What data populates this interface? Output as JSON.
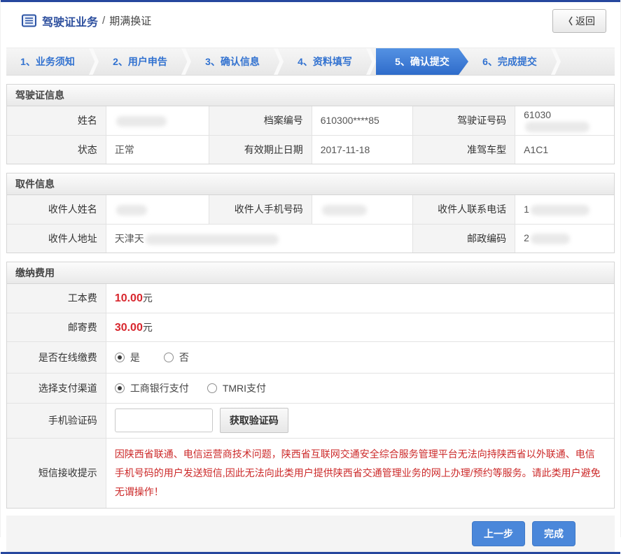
{
  "header": {
    "title": "驾驶证业务",
    "separator": "/",
    "subtitle": "期满换证",
    "back": {
      "icon": "〈",
      "label": "返回"
    }
  },
  "steps": [
    {
      "label": "1、业务须知",
      "active": false
    },
    {
      "label": "2、用户申告",
      "active": false
    },
    {
      "label": "3、确认信息",
      "active": false
    },
    {
      "label": "4、资料填写",
      "active": false
    },
    {
      "label": "5、确认提交",
      "active": true
    },
    {
      "label": "6、完成提交",
      "active": false
    }
  ],
  "sections": {
    "license": {
      "title": "驾驶证信息",
      "rows": [
        [
          {
            "label": "姓名",
            "value": "",
            "redacted": true
          },
          {
            "label": "档案编号",
            "value": "610300****85",
            "redacted": false
          },
          {
            "label": "驾驶证号码",
            "value": "61030",
            "redacted": true
          }
        ],
        [
          {
            "label": "状态",
            "value": "正常",
            "redacted": false
          },
          {
            "label": "有效期止日期",
            "value": "2017-11-18",
            "redacted": false
          },
          {
            "label": "准驾车型",
            "value": "A1C1",
            "redacted": false
          }
        ]
      ]
    },
    "pickup": {
      "title": "取件信息",
      "rows": [
        [
          {
            "label": "收件人姓名",
            "value": "",
            "redacted": true
          },
          {
            "label": "收件人手机号码",
            "value": "",
            "redacted": true
          },
          {
            "label": "收件人联系电话",
            "value": "1",
            "redacted": true
          }
        ],
        [
          {
            "label": "收件人地址",
            "value": "天津天",
            "redacted": true
          },
          {
            "label": "邮政编码",
            "value": "2",
            "redacted": true
          }
        ]
      ]
    },
    "payment": {
      "title": "缴纳费用",
      "fees": [
        {
          "label": "工本费",
          "amount": "10.00",
          "unit": "元"
        },
        {
          "label": "邮寄费",
          "amount": "30.00",
          "unit": "元"
        }
      ],
      "online": {
        "label": "是否在线缴费",
        "options": [
          {
            "label": "是",
            "checked": true
          },
          {
            "label": "否",
            "checked": false
          }
        ]
      },
      "channel": {
        "label": "选择支付渠道",
        "options": [
          {
            "label": "工商银行支付",
            "checked": true
          },
          {
            "label": "TMRI支付",
            "checked": false
          }
        ]
      },
      "code": {
        "label": "手机验证码",
        "input_value": "",
        "button_label": "获取验证码"
      },
      "notice": {
        "label": "短信接收提示",
        "text": "因陕西省联通、电信运营商技术问题，陕西省互联网交通安全综合服务管理平台无法向持陕西省以外联通、电信手机号码的用户发送短信,因此无法向此类用户提供陕西省交通管理业务的网上办理/预约等服务。请此类用户避免无谓操作！"
      }
    }
  },
  "footer": {
    "prev_label": "上一步",
    "finish_label": "完成"
  },
  "colors": {
    "brand_blue": "#26479e",
    "step_blue": "#3272d0",
    "active_step_bg": "#3e7cd6",
    "fee_red": "#d8272e",
    "notice_red": "#cc2a2a",
    "button_blue": "#4a87da"
  }
}
